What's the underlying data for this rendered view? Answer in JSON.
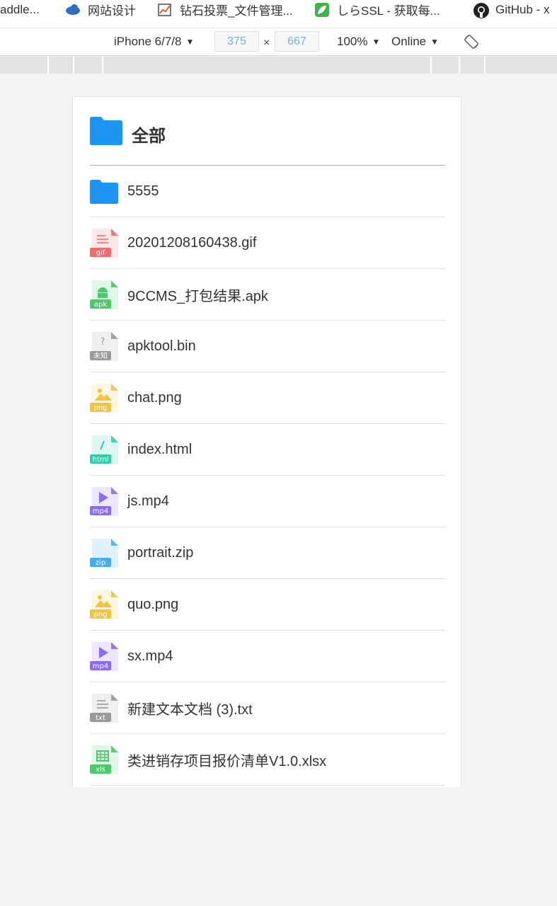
{
  "bookmarks": [
    {
      "label": "addle...",
      "icon": "none"
    },
    {
      "label": "网站设计",
      "icon": "cloud-icon"
    },
    {
      "label": "钻石投票_文件管理...",
      "icon": "chart-icon"
    },
    {
      "label": "しらSSL - 获取每...",
      "icon": "leaf-icon"
    },
    {
      "label": "GitHub - x",
      "icon": "github-icon"
    }
  ],
  "device_toolbar": {
    "device": "iPhone 6/7/8",
    "width": "375",
    "height": "667",
    "times": "×",
    "zoom": "100%",
    "network": "Online"
  },
  "page": {
    "title": "全部",
    "colors": {
      "folder": "#1c96f0",
      "accent_line": "#8ab8ef"
    },
    "files": [
      {
        "name": "5555",
        "type": "folder",
        "tag": "",
        "color": "#1c96f0"
      },
      {
        "name": "20201208160438.gif",
        "type": "gif",
        "tag": "gif",
        "color": "#f06b6b"
      },
      {
        "name": "9CCMS_打包结果.apk",
        "type": "apk",
        "tag": "apk",
        "color": "#4cc96a"
      },
      {
        "name": "apktool.bin",
        "type": "unknown",
        "tag": "未知",
        "color": "#9a9a9a"
      },
      {
        "name": "chat.png",
        "type": "png",
        "tag": "png",
        "color": "#f0c43c"
      },
      {
        "name": "index.html",
        "type": "html",
        "tag": "html",
        "color": "#2fcfa8"
      },
      {
        "name": "js.mp4",
        "type": "mp4",
        "tag": "mp4",
        "color": "#8a6cf0"
      },
      {
        "name": "portrait.zip",
        "type": "zip",
        "tag": "zip",
        "color": "#46b0ef"
      },
      {
        "name": "quo.png",
        "type": "png",
        "tag": "png",
        "color": "#f0c43c"
      },
      {
        "name": "sx.mp4",
        "type": "mp4",
        "tag": "mp4",
        "color": "#8a6cf0"
      },
      {
        "name": "新建文本文档 (3).txt",
        "type": "txt",
        "tag": "txt",
        "color": "#9a9a9a"
      },
      {
        "name": "类进销存项目报价清单V1.0.xlsx",
        "type": "xls",
        "tag": "xls",
        "color": "#4cc96a"
      }
    ]
  }
}
